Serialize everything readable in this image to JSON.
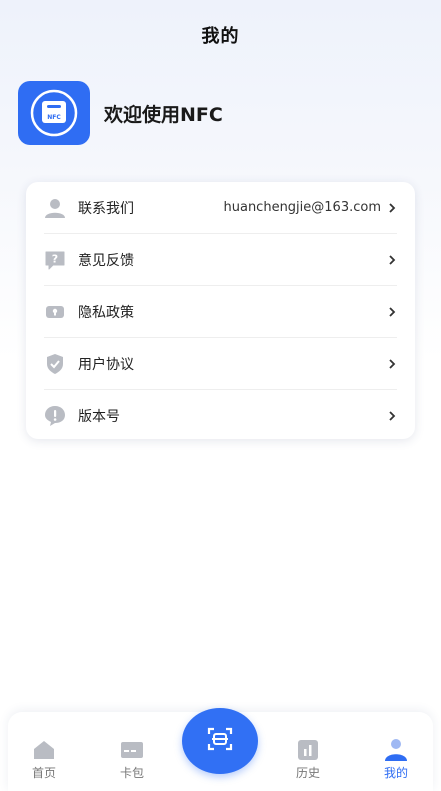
{
  "header": {
    "title": "我的"
  },
  "profile": {
    "logo_text": "NFC",
    "welcome": "欢迎使用NFC"
  },
  "menu": {
    "items": [
      {
        "icon": "user-icon",
        "label": "联系我们",
        "value": "huanchengjie@163.com"
      },
      {
        "icon": "question-bubble-icon",
        "label": "意见反馈",
        "value": ""
      },
      {
        "icon": "privacy-lock-icon",
        "label": "隐私政策",
        "value": ""
      },
      {
        "icon": "shield-check-icon",
        "label": "用户协议",
        "value": ""
      },
      {
        "icon": "exclamation-bubble-icon",
        "label": "版本号",
        "value": ""
      }
    ]
  },
  "tabbar": {
    "tabs": [
      {
        "icon": "home-icon",
        "label": "首页"
      },
      {
        "icon": "card-icon",
        "label": "卡包"
      },
      {
        "icon": "history-icon",
        "label": "历史"
      },
      {
        "icon": "profile-icon",
        "label": "我的",
        "active": true
      }
    ],
    "center_icon": "scan-icon"
  },
  "colors": {
    "accent": "#2f6df3",
    "icon_gray": "#b9bcc3",
    "text": "#222222"
  }
}
